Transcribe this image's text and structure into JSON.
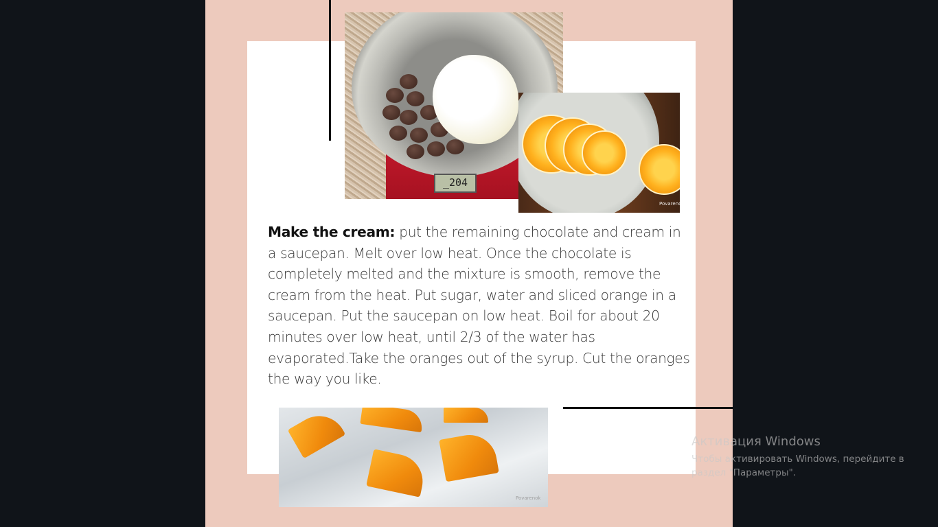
{
  "slide": {
    "recipe_heading": "Make the cream:",
    "recipe_body": " put the remaining chocolate and cream in a saucepan. Melt over low heat. Once the chocolate is completely melted and the mixture is smooth, remove the cream from the heat. Put sugar, water and sliced orange in a saucepan. Put the saucepan on low heat. Boil for about 20 minutes over low heat, until 2/3 of the water has evaporated.Take the oranges out of the syrup. Cut the oranges the way you like.",
    "scale_display": "_204",
    "photo_watermark": "Povarenok"
  },
  "activation": {
    "title": "Активация Windows",
    "subtitle_line1": "Чтобы активировать Windows, перейдите в",
    "subtitle_line2": "раздел \"Параметры\"."
  },
  "colors": {
    "background": "#101419",
    "slide_bg": "#edcabd",
    "card_bg": "#ffffff",
    "accent_line": "#111111"
  }
}
